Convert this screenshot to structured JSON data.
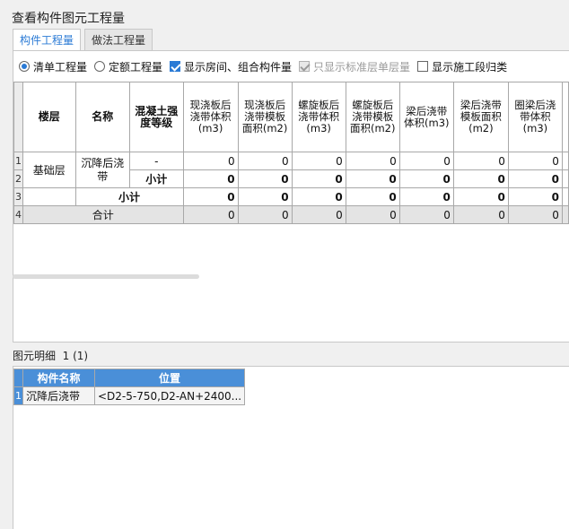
{
  "window": {
    "title": "查看构件图元工程量"
  },
  "tabs": [
    {
      "label": "构件工程量",
      "active": true
    },
    {
      "label": "做法工程量",
      "active": false
    }
  ],
  "options": {
    "radio_qd": "清单工程量",
    "radio_de": "定额工程量",
    "cb_show_room": "显示房间、组合构件量",
    "cb_std_floor": "只显示标准层单层量",
    "cb_construction": "显示施工段归类"
  },
  "table": {
    "headers": {
      "floor": "楼层",
      "name": "名称",
      "grade": "混凝土强度等级",
      "c1": "现浇板后浇带体积(m3)",
      "c2": "现浇板后浇带模板面积(m2)",
      "c3": "螺旋板后浇带体积(m3)",
      "c4": "螺旋板后浇带模板面积(m2)",
      "c5": "梁后浇带体积(m3)",
      "c6": "梁后浇带模板面积(m2)",
      "c7": "圈梁后浇带体积(m3)"
    },
    "row_numbers": [
      "1",
      "2",
      "3",
      "4"
    ],
    "floor_value": "基础层",
    "name_value": "沉降后浇带",
    "grade_value": "-",
    "subtotal": "小计",
    "total": "合计",
    "zero": "0"
  },
  "detail": {
    "label": "图元明细",
    "count": "1 (1)",
    "headers": {
      "name": "构件名称",
      "position": "位置"
    },
    "rows": [
      {
        "num": "1",
        "name": "沉降后浇带",
        "position": "<D2-5-750,D2-AN+2400..."
      }
    ]
  },
  "colors": {
    "accent": "#2a7ad5",
    "detail_header": "#4a8fd8"
  }
}
